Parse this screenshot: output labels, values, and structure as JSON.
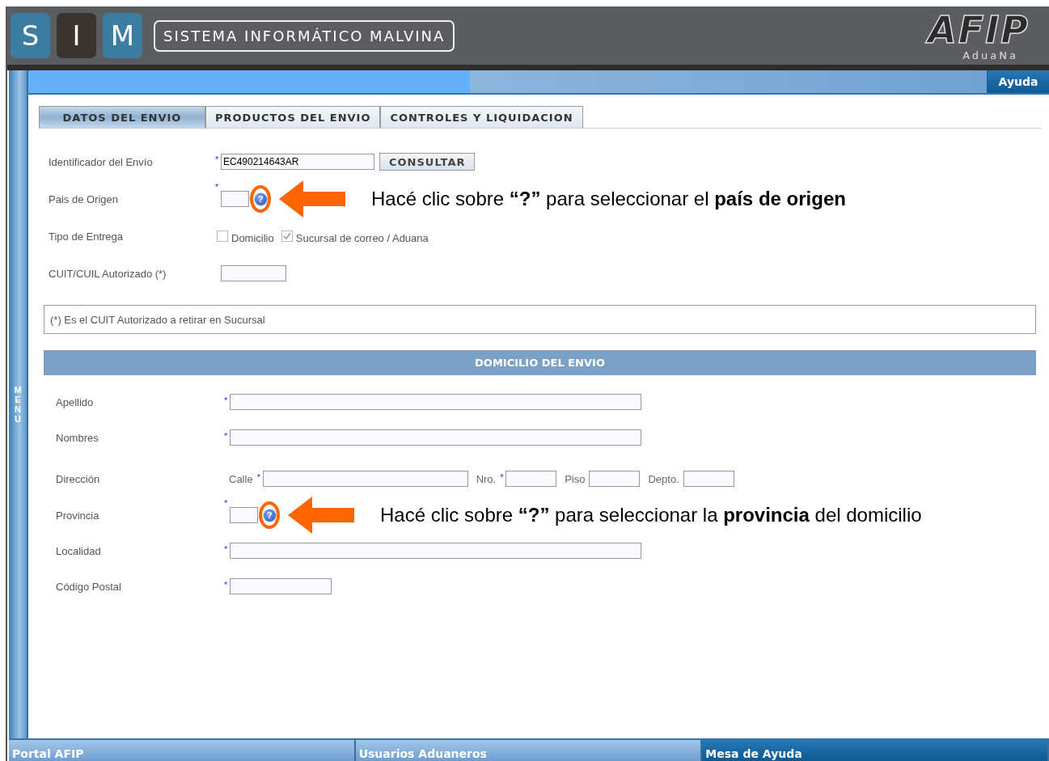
{
  "header": {
    "logo_letters": [
      {
        "text": "S",
        "color": "#3b7ea1"
      },
      {
        "text": "I",
        "color": "#3a3330"
      },
      {
        "text": "M",
        "color": "#3b7ea1"
      }
    ],
    "system_title": "SISTEMA INFORMÁTICO MALVINA",
    "brand_logo": "AFIP",
    "brand_sub": "AduaNa"
  },
  "menu_label": "MENU",
  "help_button": "Ayuda",
  "tabs": [
    {
      "label": "DATOS DEL ENVIO",
      "selected": true
    },
    {
      "label": "PRODUCTOS DEL ENVIO",
      "selected": false
    },
    {
      "label": "CONTROLES Y LIQUIDACION",
      "selected": false
    }
  ],
  "shipment_rows": [
    {
      "kind": "long",
      "label": "Identificador del Envío",
      "required_mark": "*",
      "value": "EC490214643AR",
      "button": "CONSULTAR"
    },
    {
      "kind": "lookup",
      "label": "Pais de Origen",
      "required_mark": "*",
      "help_symbol": "?",
      "annotation": "Hacé clic sobre **“?”** para seleccionar el **país de origen**"
    },
    {
      "kind": "checks",
      "label": "Tipo de Entrega",
      "options": [
        {
          "label": "Domicilio",
          "checked": false
        },
        {
          "label": "Sucursal de correo / Aduana",
          "checked": true
        }
      ]
    },
    {
      "kind": "short",
      "label": "CUIT/CUIL Autorizado (*)"
    }
  ],
  "note": "(*) Es el CUIT Autorizado a retirar en Sucursal",
  "section_title": "DOMICILIO DEL ENVIO",
  "address_rows": [
    {
      "kind": "long",
      "label": "Apellido",
      "required_mark": "*"
    },
    {
      "kind": "long",
      "label": "Nombres",
      "required_mark": "*"
    },
    {
      "kind": "street",
      "label": "Dirección",
      "parts": [
        {
          "label": "Calle",
          "required_mark": "*"
        },
        {
          "label": "Nro.",
          "required_mark": "*"
        },
        {
          "label": "Piso"
        },
        {
          "label": "Depto."
        }
      ]
    },
    {
      "kind": "lookup",
      "label": "Provincia",
      "required_mark": "*",
      "help_symbol": "?",
      "annotation": "Hacé clic sobre **“?”** para seleccionar la **provincia** del domicilio"
    },
    {
      "kind": "long",
      "label": "Localidad",
      "required_mark": "*"
    },
    {
      "kind": "medium",
      "label": "Código Postal",
      "required_mark": "*"
    }
  ],
  "footer": [
    "Portal AFIP",
    "Usuarios Aduaneros",
    "Mesa de Ayuda"
  ]
}
